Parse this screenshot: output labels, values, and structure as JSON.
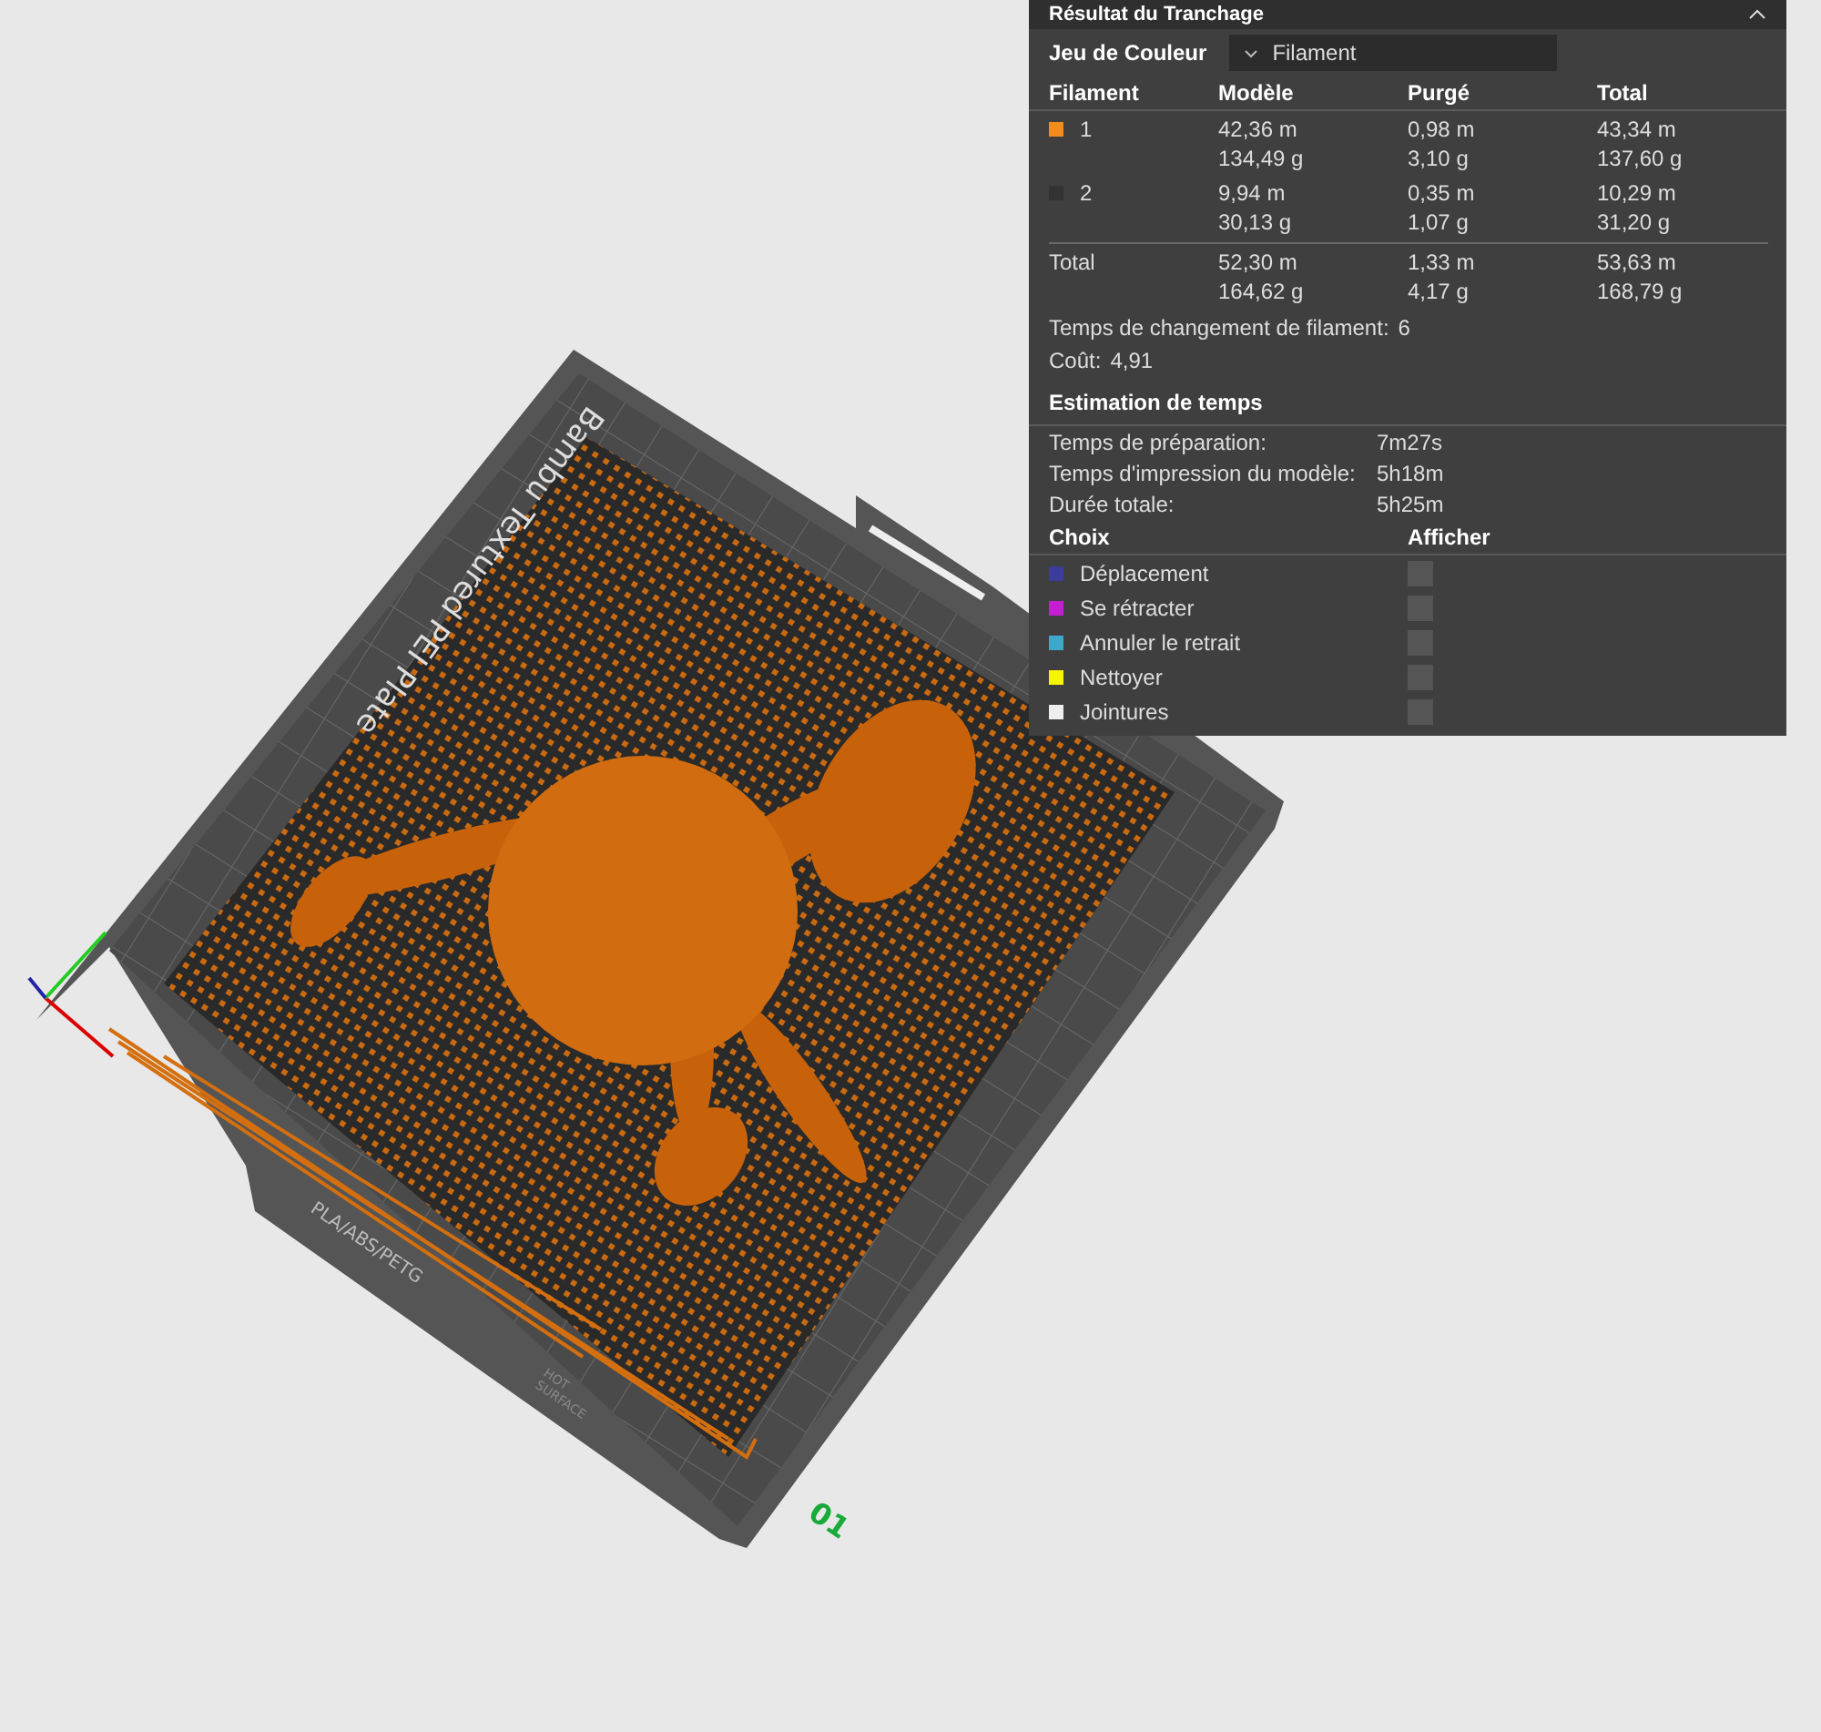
{
  "scene": {
    "plate_name": "Bambu Textured PEI Plate",
    "material_label": "PLA/ABS/PETG",
    "warning": [
      "HOT",
      "SURFACE"
    ],
    "plate_number": "01"
  },
  "panel": {
    "title": "Résultat du Tranchage",
    "color_scheme": {
      "label": "Jeu de Couleur",
      "value": "Filament"
    },
    "filament_table": {
      "columns": [
        "Filament",
        "Modèle",
        "Purgé",
        "Total"
      ],
      "rows": [
        {
          "label": "1",
          "color": "#f28c1e",
          "model": [
            "42,36 m",
            "134,49 g"
          ],
          "purged": [
            "0,98 m",
            "3,10 g"
          ],
          "total": [
            "43,34 m",
            "137,60 g"
          ]
        },
        {
          "label": "2",
          "color": "#333333",
          "model": [
            "9,94 m",
            "30,13 g"
          ],
          "purged": [
            "0,35 m",
            "1,07 g"
          ],
          "total": [
            "10,29 m",
            "31,20 g"
          ]
        }
      ],
      "total_row": {
        "label": "Total",
        "model": [
          "52,30 m",
          "164,62 g"
        ],
        "purged": [
          "1,33 m",
          "4,17 g"
        ],
        "total": [
          "53,63 m",
          "168,79 g"
        ]
      }
    },
    "filament_changes": {
      "label": "Temps de changement de filament:",
      "value": "6"
    },
    "cost": {
      "label": "Coût:",
      "value": "4,91"
    },
    "time_estimate": {
      "title": "Estimation de temps",
      "rows": [
        {
          "label": "Temps de préparation:",
          "value": "7m27s"
        },
        {
          "label": "Temps d'impression du modèle:",
          "value": "5h18m"
        },
        {
          "label": "Durée totale:",
          "value": "5h25m"
        }
      ]
    },
    "options": {
      "columns": [
        "Choix",
        "Afficher"
      ],
      "items": [
        {
          "label": "Déplacement",
          "color": "#3c3c9c",
          "checked": false
        },
        {
          "label": "Se rétracter",
          "color": "#c21fd1",
          "checked": false
        },
        {
          "label": "Annuler le retrait",
          "color": "#3fa6cc",
          "checked": false
        },
        {
          "label": "Nettoyer",
          "color": "#f5f500",
          "checked": false
        },
        {
          "label": "Jointures",
          "color": "#eeeeee",
          "checked": false
        }
      ]
    }
  }
}
